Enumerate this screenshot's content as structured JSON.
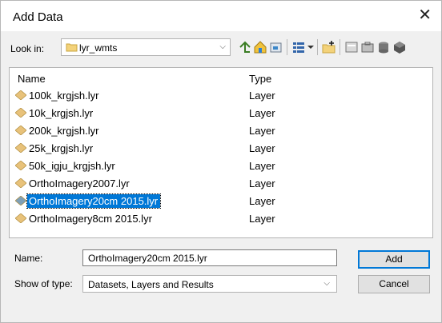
{
  "window": {
    "title": "Add Data",
    "close_glyph": "✕"
  },
  "lookin": {
    "label": "Look in:",
    "value": "lyr_wmts",
    "folder_icon": "folder-icon",
    "dropdown_glyph": "⌵"
  },
  "toolbar": {
    "icons": [
      "up-one-level-icon",
      "home-icon",
      "connect-to-folder-icon",
      "view-menu-icon",
      "new-folder-icon",
      "catalog-icon",
      "toolbox-icon",
      "database-icon",
      "geodatabase-icon"
    ]
  },
  "list": {
    "headers": {
      "name": "Name",
      "type": "Type"
    },
    "accent_selected": "#0078d7",
    "layer_icon_color": "#e8c27a",
    "selected_icon_color": "#7f9fb6",
    "items": [
      {
        "name": "100k_krgjsh.lyr",
        "type": "Layer"
      },
      {
        "name": "10k_krgjsh.lyr",
        "type": "Layer"
      },
      {
        "name": "200k_krgjsh.lyr",
        "type": "Layer"
      },
      {
        "name": "25k_krgjsh.lyr",
        "type": "Layer"
      },
      {
        "name": "50k_igju_krgjsh.lyr",
        "type": "Layer"
      },
      {
        "name": "OrthoImagery2007.lyr",
        "type": "Layer"
      },
      {
        "name": "OrthoImagery20cm 2015.lyr",
        "type": "Layer",
        "selected": true
      },
      {
        "name": "OrthoImagery8cm 2015.lyr",
        "type": "Layer"
      }
    ]
  },
  "footer": {
    "name_label": "Name:",
    "name_value": "OrthoImagery20cm 2015.lyr",
    "type_label": "Show of type:",
    "type_value": "Datasets, Layers and Results",
    "add_label": "Add",
    "cancel_label": "Cancel"
  }
}
